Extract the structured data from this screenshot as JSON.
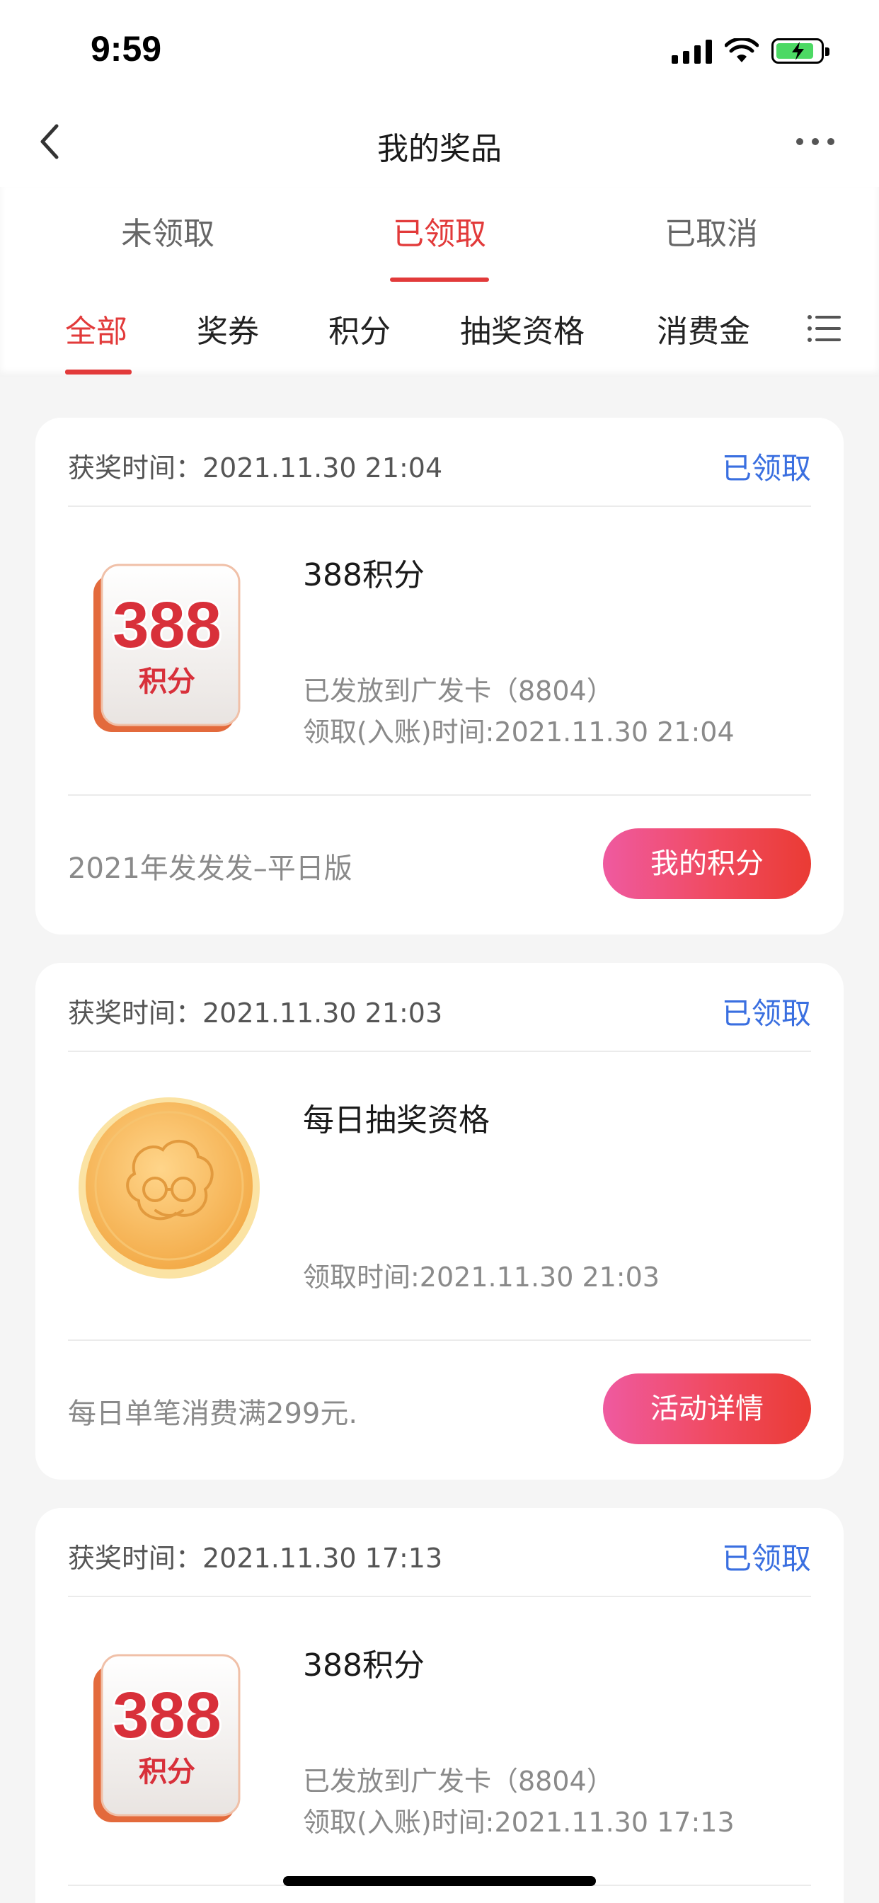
{
  "status_bar": {
    "time": "9:59"
  },
  "nav": {
    "title": "我的奖品"
  },
  "status_tabs": [
    {
      "label": "未领取"
    },
    {
      "label": "已领取",
      "active": true
    },
    {
      "label": "已取消"
    }
  ],
  "category_tabs": [
    {
      "label": "全部",
      "active": true
    },
    {
      "label": "奖券"
    },
    {
      "label": "积分"
    },
    {
      "label": "抽奖资格"
    },
    {
      "label": "消费金"
    }
  ],
  "prizes": [
    {
      "award_time": "获奖时间：2021.11.30 21:04",
      "status": "已领取",
      "image": {
        "type": "points-badge",
        "number": "388",
        "caption": "积分"
      },
      "name": "388积分",
      "info": [
        "已发放到广发卡（8804）",
        "领取(入账)时间:2021.11.30 21:04"
      ],
      "campaign": "2021年发发发–平日版",
      "button": "我的积分"
    },
    {
      "award_time": "获奖时间：2021.11.30 21:03",
      "status": "已领取",
      "image": {
        "type": "gold-coin"
      },
      "name": "每日抽奖资格",
      "info": [
        "领取时间:2021.11.30 21:03"
      ],
      "campaign": "每日单笔消费满299元.",
      "button": "活动详情"
    },
    {
      "award_time": "获奖时间：2021.11.30 17:13",
      "status": "已领取",
      "image": {
        "type": "points-badge",
        "number": "388",
        "caption": "积分"
      },
      "name": "388积分",
      "info": [
        "已发放到广发卡（8804）",
        "领取(入账)时间:2021.11.30 17:13"
      ]
    }
  ],
  "colors": {
    "accent_red": "#e23a3a",
    "claimed_blue": "#3a6fe0",
    "button_start": "#ef5aa0",
    "button_end": "#ea3b34"
  }
}
